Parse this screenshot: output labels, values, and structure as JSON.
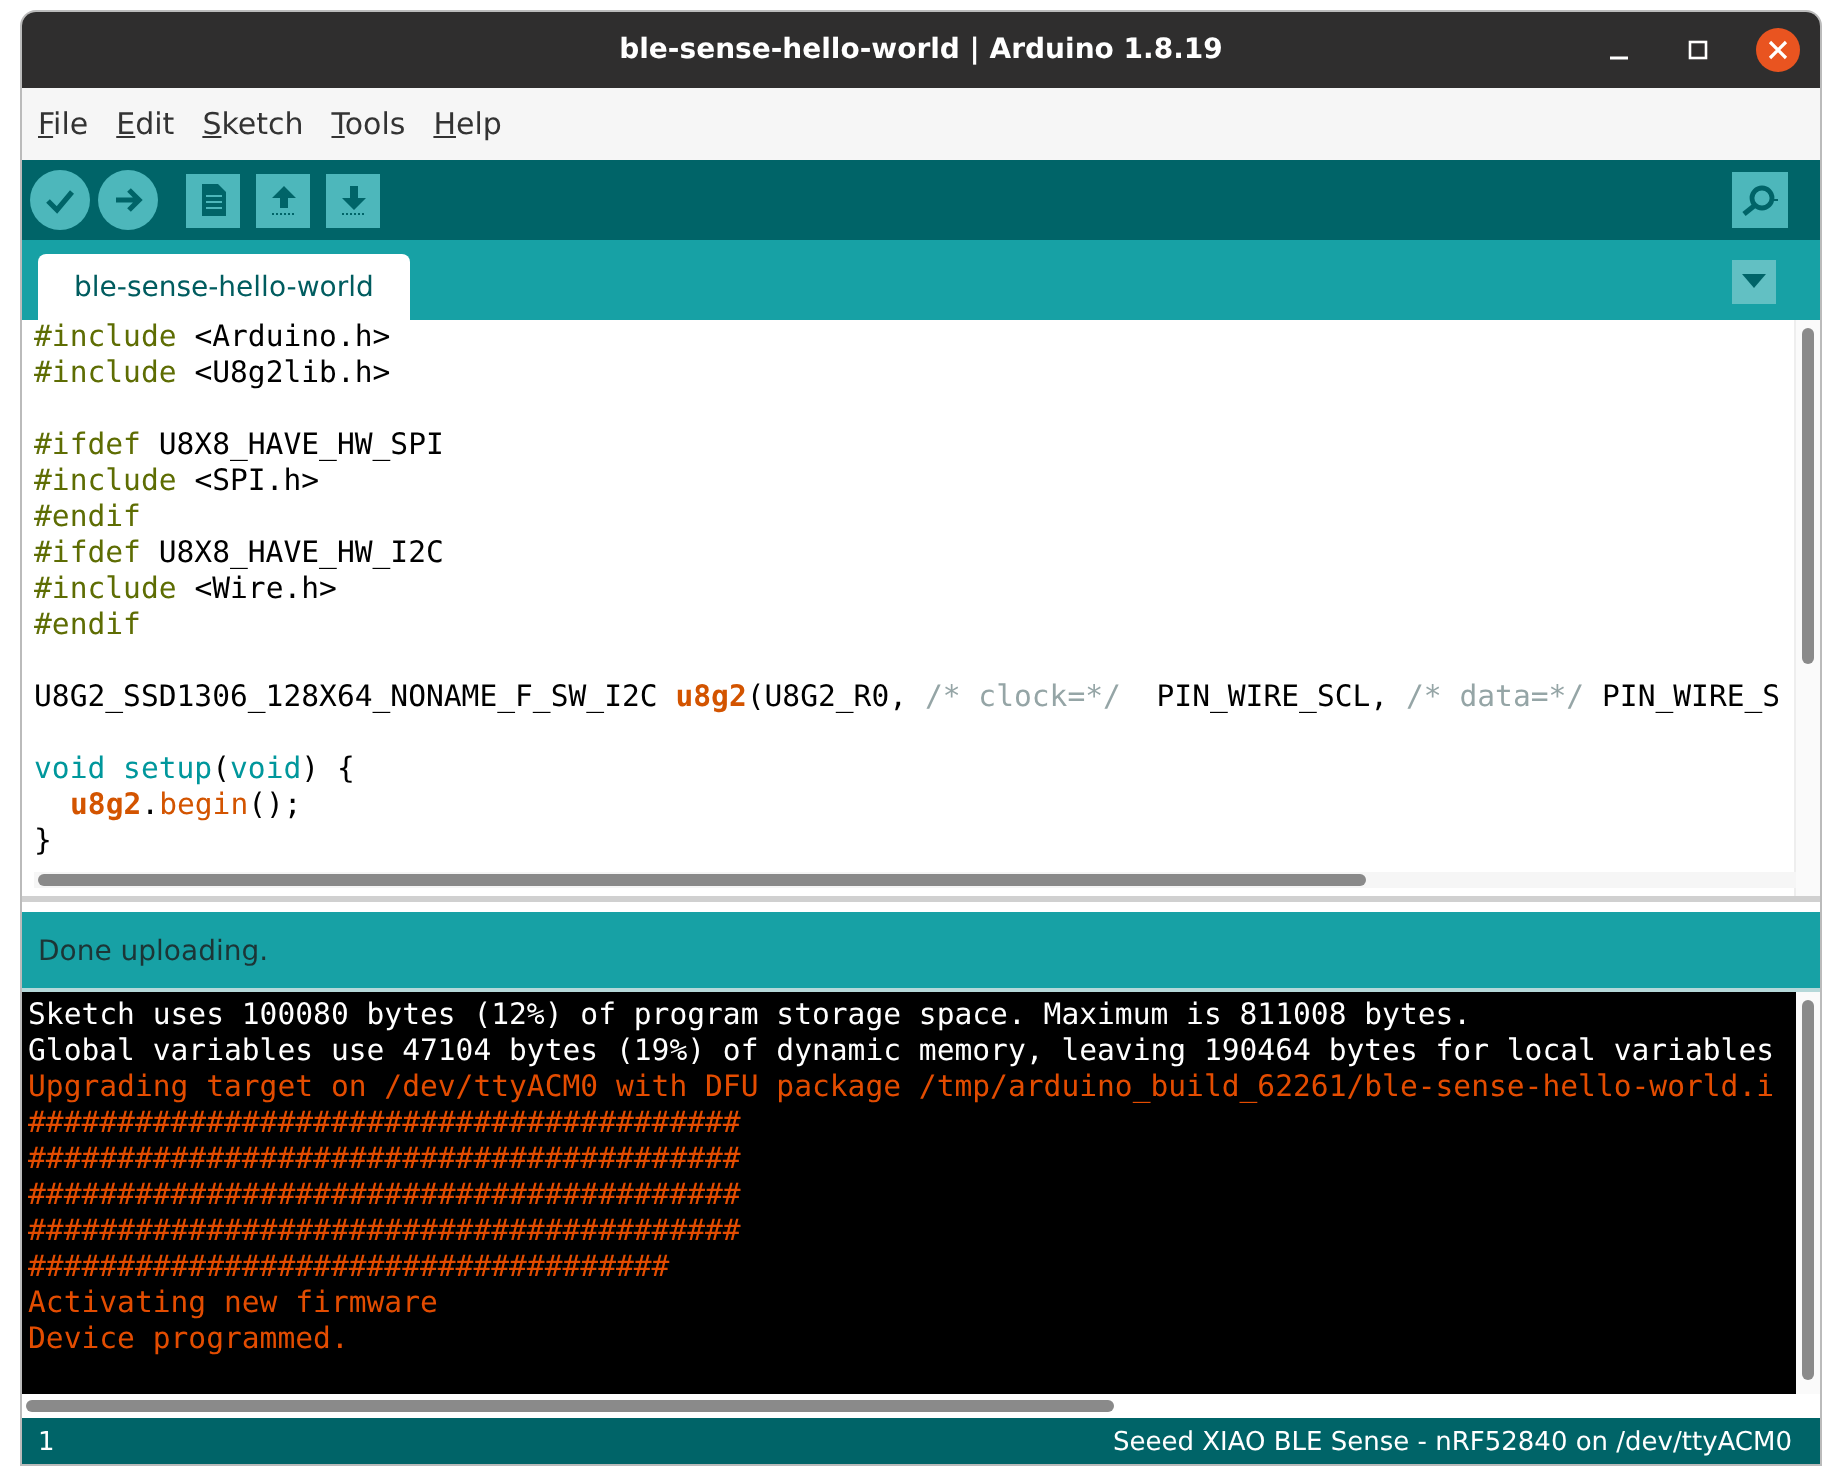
{
  "window": {
    "title": "ble-sense-hello-world | Arduino 1.8.19"
  },
  "menu": [
    {
      "label": "File"
    },
    {
      "label": "Edit"
    },
    {
      "label": "Sketch"
    },
    {
      "label": "Tools"
    },
    {
      "label": "Help"
    }
  ],
  "tabs": [
    {
      "label": "ble-sense-hello-world",
      "selected": true
    }
  ],
  "editor": {
    "lines": [
      {
        "kind": "code",
        "tokens": [
          {
            "kind": "directive",
            "text": "#include"
          },
          {
            "kind": "plain",
            "text": " <Arduino.h>"
          }
        ]
      },
      {
        "kind": "code",
        "tokens": [
          {
            "kind": "directive",
            "text": "#include"
          },
          {
            "kind": "plain",
            "text": " <U8g2lib.h>"
          }
        ]
      },
      {
        "kind": "blank"
      },
      {
        "kind": "code",
        "tokens": [
          {
            "kind": "directive",
            "text": "#ifdef"
          },
          {
            "kind": "plain",
            "text": " U8X8_HAVE_HW_SPI"
          }
        ]
      },
      {
        "kind": "code",
        "tokens": [
          {
            "kind": "directive",
            "text": "#include"
          },
          {
            "kind": "plain",
            "text": " <SPI.h>"
          }
        ]
      },
      {
        "kind": "code",
        "tokens": [
          {
            "kind": "directive",
            "text": "#endif"
          }
        ]
      },
      {
        "kind": "code",
        "tokens": [
          {
            "kind": "directive",
            "text": "#ifdef"
          },
          {
            "kind": "plain",
            "text": " U8X8_HAVE_HW_I2C"
          }
        ]
      },
      {
        "kind": "code",
        "tokens": [
          {
            "kind": "directive",
            "text": "#include"
          },
          {
            "kind": "plain",
            "text": " <Wire.h>"
          }
        ]
      },
      {
        "kind": "code",
        "tokens": [
          {
            "kind": "directive",
            "text": "#endif"
          }
        ]
      },
      {
        "kind": "blank"
      },
      {
        "kind": "code",
        "tokens": [
          {
            "kind": "plain",
            "text": "U8G2_SSD1306_128X64_NONAME_F_SW_I2C "
          },
          {
            "kind": "object",
            "text": "u8g2"
          },
          {
            "kind": "plain",
            "text": "(U8G2_R0, "
          },
          {
            "kind": "comment",
            "text": "/* clock=*/"
          },
          {
            "kind": "plain",
            "text": "  PIN_WIRE_SCL, "
          },
          {
            "kind": "comment",
            "text": "/* data=*/"
          },
          {
            "kind": "plain",
            "text": " PIN_WIRE_S"
          }
        ]
      },
      {
        "kind": "blank"
      },
      {
        "kind": "code",
        "tokens": [
          {
            "kind": "keyword",
            "text": "void setup"
          },
          {
            "kind": "plain",
            "text": "("
          },
          {
            "kind": "keyword",
            "text": "void"
          },
          {
            "kind": "plain",
            "text": ") {"
          }
        ]
      },
      {
        "kind": "indented",
        "tokens": [
          {
            "kind": "object",
            "text": "u8g2"
          },
          {
            "kind": "plain",
            "text": "."
          },
          {
            "kind": "method",
            "text": "begin"
          },
          {
            "kind": "plain",
            "text": "();"
          }
        ]
      },
      {
        "kind": "code",
        "tokens": [
          {
            "kind": "plain",
            "text": "}"
          }
        ]
      }
    ]
  },
  "message": "Done uploading.",
  "console": [
    {
      "kind": "info",
      "text": "Sketch uses 100080 bytes (12%) of program storage space. Maximum is 811008 bytes."
    },
    {
      "kind": "info",
      "text": "Global variables use 47104 bytes (19%) of dynamic memory, leaving 190464 bytes for local variables"
    },
    {
      "kind": "error",
      "text": "Upgrading target on /dev/ttyACM0 with DFU package /tmp/arduino_build_62261/ble-sense-hello-world.i"
    },
    {
      "kind": "error",
      "text": "########################################"
    },
    {
      "kind": "error",
      "text": "########################################"
    },
    {
      "kind": "error",
      "text": "########################################"
    },
    {
      "kind": "error",
      "text": "########################################"
    },
    {
      "kind": "error",
      "text": "####################################"
    },
    {
      "kind": "error",
      "text": "Activating new firmware"
    },
    {
      "kind": "error",
      "text": "Device programmed."
    }
  ],
  "status_bar": {
    "line": "1",
    "board": "Seeed XIAO BLE Sense - nRF52840 on /dev/ttyACM0"
  }
}
